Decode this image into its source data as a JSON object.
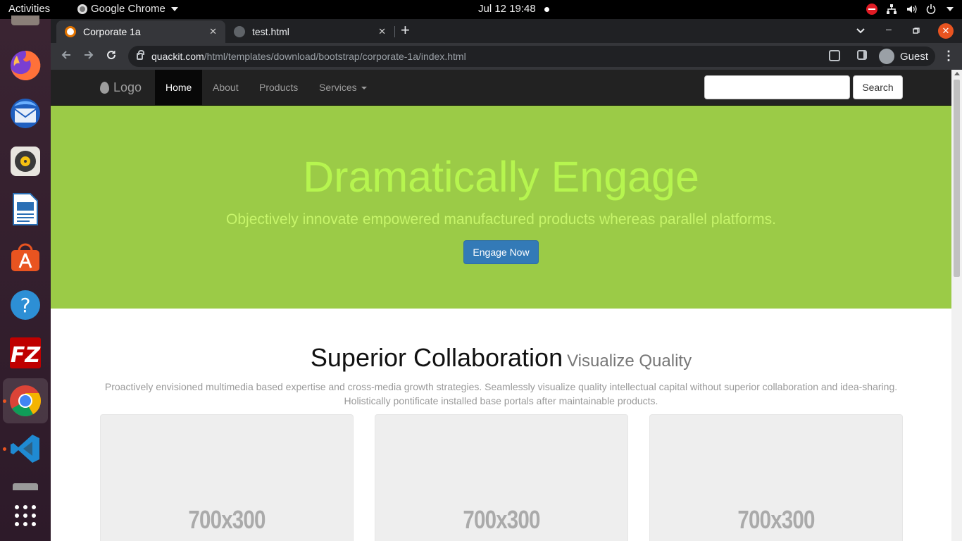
{
  "topbar": {
    "activities": "Activities",
    "app_name": "Google Chrome",
    "clock": "Jul 12  19:48"
  },
  "dock": {
    "items": [
      "firefox-icon",
      "thunderbird-icon",
      "rhythmbox-icon",
      "libreoffice-writer-icon",
      "ubuntu-software-icon",
      "help-icon",
      "filezilla-icon",
      "chrome-icon",
      "vscode-icon",
      "show-apps-icon"
    ]
  },
  "browser": {
    "tabs": [
      {
        "title": "Corporate 1a",
        "active": true
      },
      {
        "title": "test.html",
        "active": false
      }
    ],
    "url_host": "quackit.com",
    "url_path": "/html/templates/download/bootstrap/corporate-1a/index.html",
    "profile": "Guest"
  },
  "site": {
    "brand": "Logo",
    "nav": [
      "Home",
      "About",
      "Products",
      "Services"
    ],
    "search_button": "Search",
    "hero": {
      "title": "Dramatically Engage",
      "subtitle": "Objectively innovate empowered manufactured products whereas parallel platforms.",
      "button": "Engage Now"
    },
    "section": {
      "title": "Superior Collaboration",
      "subtitle": "Visualize Quality",
      "lead_line1": "Proactively envisioned multimedia based expertise and cross-media growth strategies. Seamlessly visualize quality intellectual capital without superior collaboration and idea-sharing.",
      "lead_line2": "Holistically pontificate installed base portals after maintainable products."
    },
    "placeholders": [
      "700x300",
      "700x300",
      "700x300"
    ]
  },
  "colors": {
    "hero_bg": "#9bcb47",
    "nav_bg": "#222222",
    "primary_button": "#337ab7",
    "ubuntu_orange": "#e95420"
  }
}
